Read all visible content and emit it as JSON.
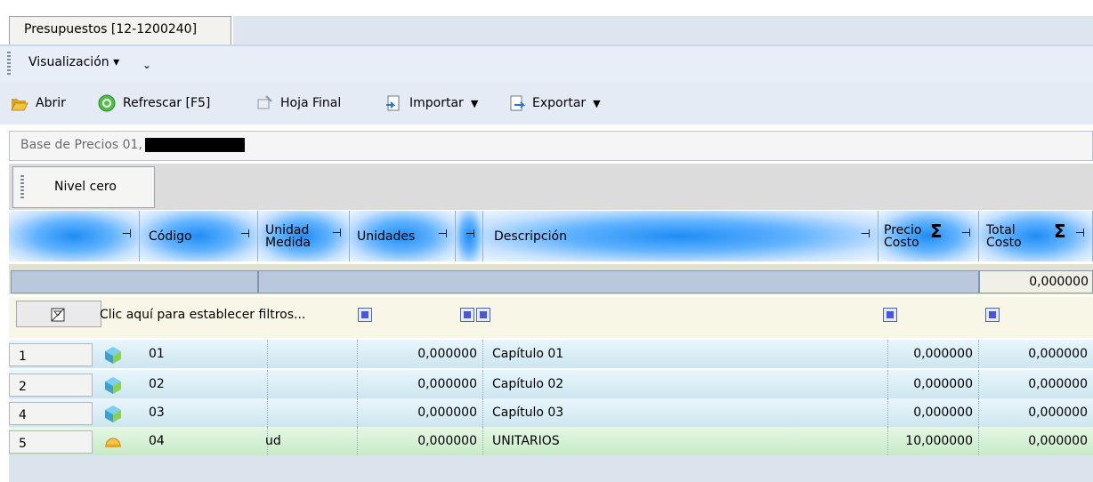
{
  "document_tab": "Presupuestos [12-1200240]",
  "menu": {
    "visualizacion": "Visualización ▾"
  },
  "toolbar": {
    "open": "Abrir",
    "refresh": "Refrescar [F5]",
    "final_sheet": "Hoja Final",
    "import": "Importar",
    "export": "Exportar"
  },
  "info_bar": {
    "text": "Base de Precios 01,"
  },
  "group_button": "Nivel cero",
  "columns": {
    "codigo": "Código",
    "unidad_1": "Unidad",
    "unidad_2": "Medida",
    "unidades": "Unidades",
    "descripcion": "Descripción",
    "precio_1": "Precio",
    "precio_2": "Costo",
    "total_1": "Total",
    "total_2": "Costo",
    "sigma": "Σ",
    "pin": "⊣"
  },
  "summary": {
    "total_costo": "0,000000"
  },
  "filter_row": {
    "prompt": "Clic aquí para establecer filtros..."
  },
  "rows": [
    {
      "num": "1",
      "codigo": "01",
      "unidad": "",
      "unidades": "0,000000",
      "descripcion": "Capítulo 01",
      "precio": "0,000000",
      "total": "0,000000"
    },
    {
      "num": "2",
      "codigo": "02",
      "unidad": "",
      "unidades": "0,000000",
      "descripcion": "Capítulo 02",
      "precio": "0,000000",
      "total": "0,000000"
    },
    {
      "num": "4",
      "codigo": "03",
      "unidad": "",
      "unidades": "0,000000",
      "descripcion": "Capítulo 03",
      "precio": "0,000000",
      "total": "0,000000"
    },
    {
      "num": "5",
      "codigo": "04",
      "unidad": "ud",
      "unidades": "0,000000",
      "descripcion": "UNITARIOS",
      "precio": "10,000000",
      "total": "0,000000"
    }
  ],
  "colors": {
    "row_band": "#dbeef7",
    "selected_row": "#cbeccb",
    "header_accent": "#1f8df5"
  }
}
